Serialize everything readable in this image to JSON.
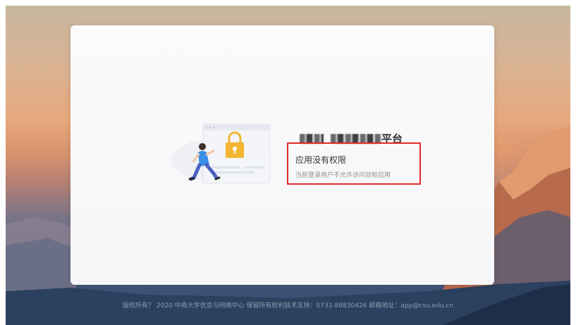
{
  "card": {
    "platform_title_visible": "平台",
    "error_title": "应用没有权限",
    "error_description": "当前登录用户不允许访问目标应用"
  },
  "footer": {
    "text": "版权所有？ 2020 中南大学信息与网络中心 保留所有权利技术支持：0731-88830426 邮箱地址：app@csu.edu.cn"
  },
  "colors": {
    "highlight_border": "#e12b2b",
    "lock_yellow": "#f3b533",
    "person_shirt": "#3a8ee6"
  },
  "icons": [
    "lock-icon",
    "person-running-illustration"
  ]
}
